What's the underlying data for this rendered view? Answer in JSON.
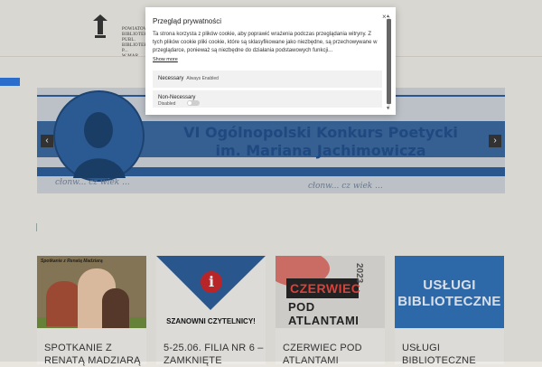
{
  "header": {
    "logo_lines": [
      "POWIATOWA",
      "BIBLIOTEKA PUBL.",
      "BIBLIOTEKA P...",
      "W MAR..."
    ]
  },
  "banner": {
    "title_line1": "VI Ogólnopolski Konkurs Poetycki",
    "title_line2": "im. Mariana Jachimowicza",
    "script_text": "cłonw... cz wiek ... ",
    "arrow_left": "‹",
    "arrow_right": "›"
  },
  "cards": [
    {
      "caption": "SPOTKANIE Z RENATĄ MADZIARĄ",
      "thumb_label": "Spotkanie z Renatą Madziarą"
    },
    {
      "caption": "5-25.06. FILIA NR 6 – ZAMKNIĘTE",
      "thumb_icon": "i",
      "thumb_text": "SZANOWNI CZYTELNICY!"
    },
    {
      "caption": "CZERWIEC POD ATLANTAMI",
      "thumb_word1": "CZERWIEC",
      "thumb_word2": "POD ATLANTAMI",
      "thumb_year": "2023"
    },
    {
      "caption": "USŁUGI BIBLIOTECZNE",
      "thumb_word1": "USŁUGI",
      "thumb_word2": "BIBLIOTECZNE"
    }
  ],
  "modal": {
    "title": "Przegląd prywatności",
    "close": "×",
    "description": "Ta strona korzysta z plików cookie, aby poprawić wrażenia podczas przeglądania witryny. Z tych plików cookie pliki cookie, które są sklasyfikowane jako niezbędne, są przechowywane w przeglądarce, ponieważ są niezbędne do działania podstawowych funkcji...",
    "show_more": "Show more",
    "necessary_label": "Necessary",
    "necessary_status": "Always Enabled",
    "non_necessary_label": "Non-Necessary",
    "non_necessary_status": "Disabled",
    "non_necessary_enabled": false
  }
}
